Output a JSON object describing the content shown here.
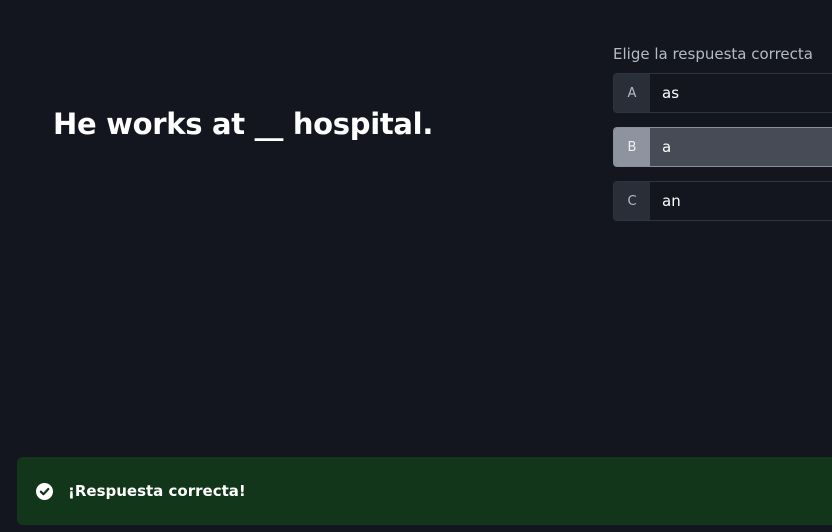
{
  "question": {
    "text": "He works at __ hospital."
  },
  "answers": {
    "prompt": "Elige la respuesta correcta",
    "options": [
      {
        "letter": "A",
        "text": "as",
        "selected": false
      },
      {
        "letter": "B",
        "text": "a",
        "selected": true
      },
      {
        "letter": "C",
        "text": "an",
        "selected": false
      }
    ]
  },
  "feedback": {
    "icon": "check-circle-icon",
    "text": "¡Respuesta correcta!",
    "status": "correct"
  },
  "colors": {
    "background": "#13161f",
    "selected_option": "#464b55",
    "success_banner": "#12361a"
  }
}
